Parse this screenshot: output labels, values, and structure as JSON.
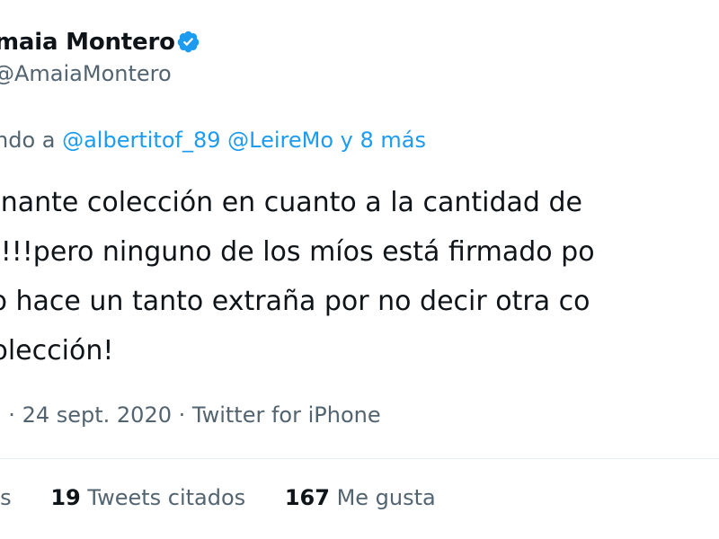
{
  "author": {
    "name": "maia Montero",
    "handle": "@AmaiaMontero",
    "verified_color": "#1d9bf0"
  },
  "reply": {
    "prefix": "ndo a ",
    "mentions": [
      "@albertitof_89",
      "@LeireMo"
    ],
    "suffix": "y 8 más"
  },
  "tweet": {
    "lines": [
      "ionante colección en cuanto a la cantidad de",
      "al!!!pero ninguno de los míos está firmado po",
      "so hace un tanto extraña por no decir otra co",
      "colección!"
    ]
  },
  "meta": {
    "time_fragment": ".",
    "date": "24 sept. 2020",
    "separator": "·",
    "source": "Twitter for iPhone"
  },
  "stats": {
    "retweets_label": "ets",
    "quote_count": "19",
    "quote_label": "Tweets citados",
    "like_count": "167",
    "like_label": "Me gusta"
  },
  "colors": {
    "text": "#0f1419",
    "muted": "#536471",
    "link": "#1d9bf0",
    "divider": "#e6ecf0"
  }
}
